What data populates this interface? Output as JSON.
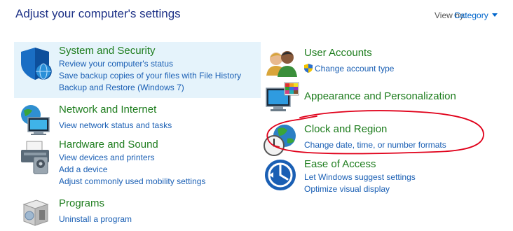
{
  "header": {
    "title": "Adjust your computer's settings",
    "view_by_label": "View by:",
    "view_by_value": "Category"
  },
  "categories": [
    {
      "heading": "System and Security",
      "links": [
        "Review your computer's status",
        "Save backup copies of your files with File History",
        "Backup and Restore (Windows 7)"
      ]
    },
    {
      "heading": "Network and Internet",
      "links": [
        "View network status and tasks"
      ]
    },
    {
      "heading": "Hardware and Sound",
      "links": [
        "View devices and printers",
        "Add a device",
        "Adjust commonly used mobility settings"
      ]
    },
    {
      "heading": "Programs",
      "links": [
        "Uninstall a program"
      ]
    },
    {
      "heading": "User Accounts",
      "links": [
        "Change account type"
      ]
    },
    {
      "heading": "Appearance and Personalization",
      "links": []
    },
    {
      "heading": "Clock and Region",
      "links": [
        "Change date, time, or number formats"
      ]
    },
    {
      "heading": "Ease of Access",
      "links": [
        "Let Windows suggest settings",
        "Optimize visual display"
      ]
    }
  ],
  "colors": {
    "heading": "#1e7d1e",
    "link": "#1a5fb4",
    "title": "#1e3287",
    "highlight": "#e5f3fb",
    "annotation": "#e0001a"
  }
}
